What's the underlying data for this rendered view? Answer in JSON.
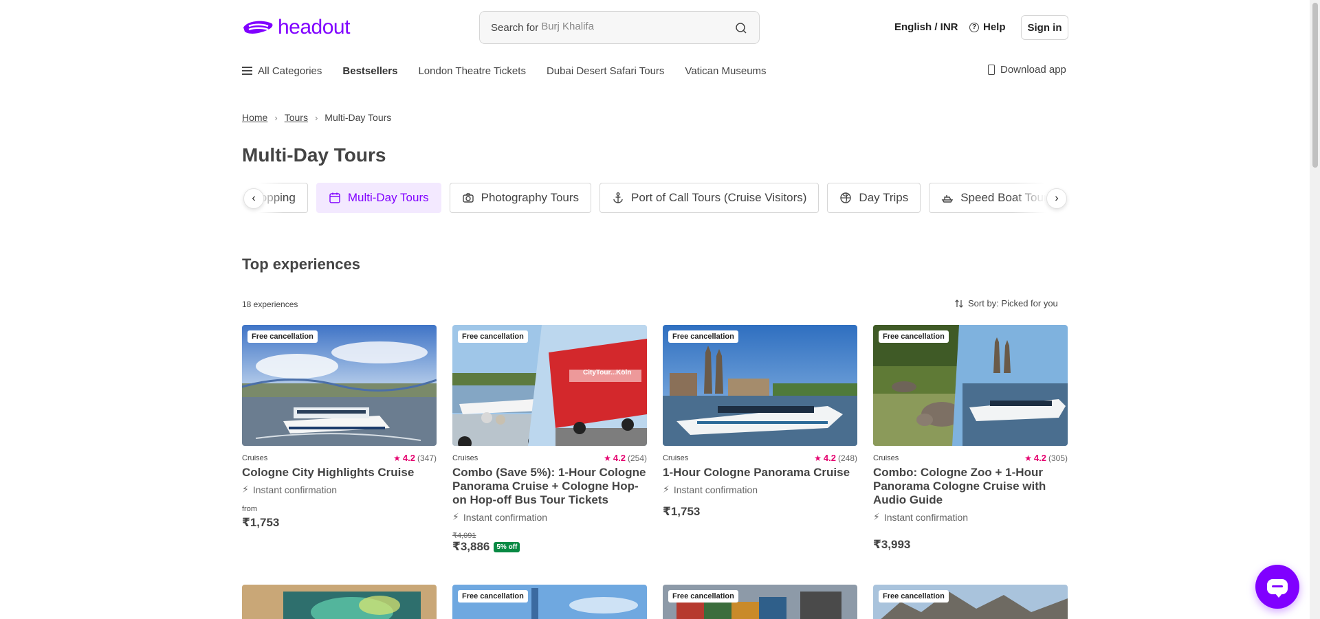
{
  "header": {
    "logo_text": "headout",
    "search_prefix": "Search for",
    "search_placeholder": "Burj Khalifa",
    "language": "English / INR",
    "help": "Help",
    "signin": "Sign in"
  },
  "nav": {
    "items": [
      {
        "label": "All Categories"
      },
      {
        "label": "Bestsellers"
      },
      {
        "label": "London Theatre Tickets"
      },
      {
        "label": "Dubai Desert Safari Tours"
      },
      {
        "label": "Vatican Museums"
      }
    ],
    "download": "Download app"
  },
  "breadcrumb": {
    "home": "Home",
    "tours": "Tours",
    "current": "Multi-Day Tours"
  },
  "page_title": "Multi-Day Tours",
  "chips": [
    {
      "label": "Shopping",
      "icon": "shopping-icon"
    },
    {
      "label": "Multi-Day Tours",
      "icon": "calendar-icon",
      "active": true
    },
    {
      "label": "Photography Tours",
      "icon": "camera-icon"
    },
    {
      "label": "Port of Call Tours (Cruise Visitors)",
      "icon": "anchor-icon"
    },
    {
      "label": "Day Trips",
      "icon": "day-trip-icon"
    },
    {
      "label": "Speed Boat Tours",
      "icon": "speed-boat-icon"
    }
  ],
  "section": {
    "title": "Top experiences",
    "count": "18 experiences",
    "sort": "Sort by: Picked for you"
  },
  "cards": [
    {
      "badge": "Free cancellation",
      "category": "Cruises",
      "rating": "4.2",
      "reviews": "(347)",
      "title": "Cologne City Highlights Cruise",
      "confirm": "Instant confirmation",
      "from": "from",
      "price": "₹1,753"
    },
    {
      "badge": "Free cancellation",
      "category": "Cruises",
      "rating": "4.2",
      "reviews": "(254)",
      "title": "Combo (Save 5%): 1-Hour Cologne Panorama Cruise + Cologne Hop-on Hop-off Bus Tour Tickets",
      "confirm": "Instant confirmation",
      "original_price": "₹4,091",
      "price": "₹3,886",
      "discount": "5% off"
    },
    {
      "badge": "Free cancellation",
      "category": "Cruises",
      "rating": "4.2",
      "reviews": "(248)",
      "title": "1-Hour Cologne Panorama Cruise",
      "confirm": "Instant confirmation",
      "price": "₹1,753"
    },
    {
      "badge": "Free cancellation",
      "category": "Cruises",
      "rating": "4.2",
      "reviews": "(305)",
      "title": "Combo: Cologne Zoo + 1-Hour Panorama Cologne Cruise with Audio Guide",
      "confirm": "Instant confirmation",
      "price": "₹3,993"
    }
  ],
  "row2_badges": [
    "Free cancellation",
    "Free cancellation",
    "Free cancellation"
  ],
  "colors": {
    "brand": "#8000ff",
    "rating": "#e5006e",
    "discount": "#088943"
  }
}
